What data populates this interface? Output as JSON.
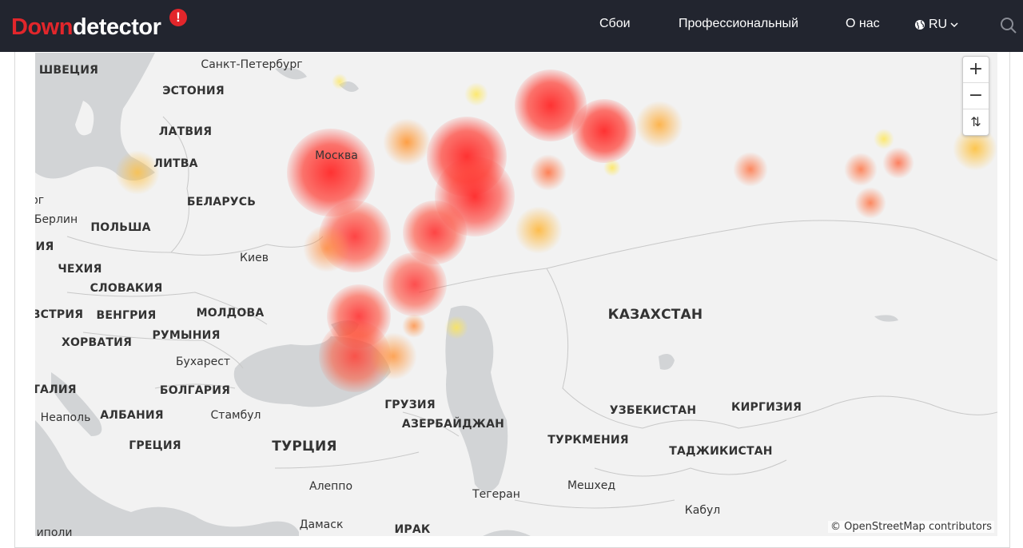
{
  "header": {
    "logo_down": "Down",
    "logo_detector": "detector",
    "logo_badge": "!",
    "nav": [
      "Сбои",
      "Профессиональный",
      "О нас"
    ],
    "lang_label": "RU",
    "icons": {
      "lang": "globe-icon",
      "chevron": "chevron-down-icon",
      "search": "search-icon"
    }
  },
  "colors": {
    "navbar": "#22252f",
    "brand_red": "#e2262b",
    "map_land": "#f2f2f2",
    "map_water": "#d2d4d6"
  },
  "map": {
    "zoom_in": "+",
    "zoom_out": "−",
    "reset": "⇅",
    "attribution": "© OpenStreetMap contributors",
    "countries": [
      "ШВЕЦИЯ",
      "ЭСТОНИЯ",
      "ЛАТВИЯ",
      "ЛИТВА",
      "БЕЛАРУСЬ",
      "ПОЛЬША",
      "ЧЕХИЯ",
      "СЛОВАКИЯ",
      "ВЕНГРИЯ",
      "МОЛДОВА",
      "РУМЫНИЯ",
      "ХОРВАТИЯ",
      "БОЛГАРИЯ",
      "АЛБАНИЯ",
      "ГРЕЦИЯ",
      "ТУРЦИЯ",
      "ГРУЗИЯ",
      "АЗЕРБАЙДЖАН",
      "КАЗАХСТАН",
      "УЗБЕКИСТАН",
      "ТУРКМЕНИЯ",
      "КИРГИЗИЯ",
      "ТАДЖИКИСТАН",
      "ИЯ",
      "ВСТРИЯ",
      "ТАЛИЯ",
      "ИРАК"
    ],
    "cities": [
      "Санкт-Петербург",
      "Москва",
      "Берлин",
      "Киев",
      "Бухарест",
      "Стамбул",
      "Неаполь",
      "Алеппо",
      "Тегеран",
      "Мешхед",
      "Кабул",
      "Дамаск",
      "рг",
      "иполи"
    ]
  }
}
